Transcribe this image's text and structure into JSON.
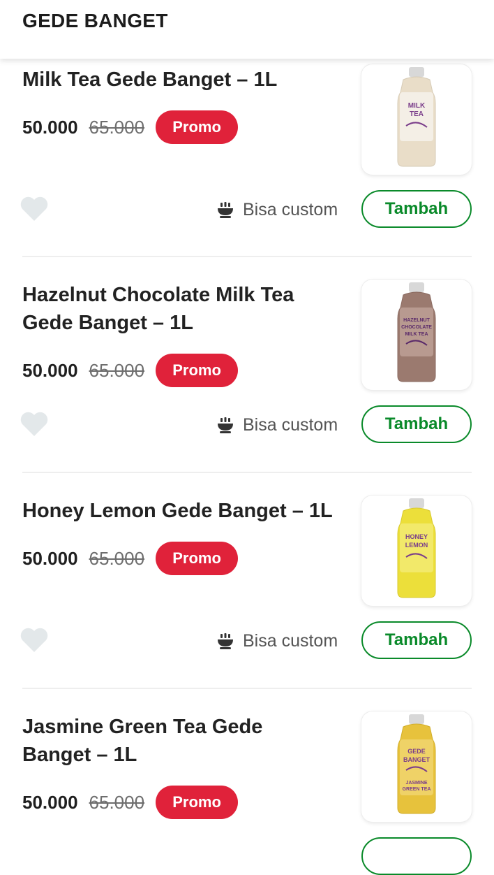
{
  "header": {
    "title": "GEDE BANGET"
  },
  "items": [
    {
      "name": "Milk Tea Gede Banget – 1L",
      "price": "50.000",
      "old_price": "65.000",
      "badge": "Promo",
      "custom_label": "Bisa custom",
      "add_label": "Tambah",
      "bottle": {
        "liquid": "#e9ddc8",
        "label": "#f4efe6",
        "brand": "#7a3d8a",
        "text": "MILK TEA"
      }
    },
    {
      "name": "Hazelnut Chocolate Milk Tea Gede Banget – 1L",
      "price": "50.000",
      "old_price": "65.000",
      "badge": "Promo",
      "custom_label": "Bisa custom",
      "add_label": "Tambah",
      "bottle": {
        "liquid": "#9b7a6f",
        "label": "#b89a90",
        "brand": "#5a2a6a",
        "text": "HAZELNUT CHOCOLATE"
      }
    },
    {
      "name": "Honey Lemon Gede Banget – 1L",
      "price": "50.000",
      "old_price": "65.000",
      "badge": "Promo",
      "custom_label": "Bisa custom",
      "add_label": "Tambah",
      "bottle": {
        "liquid": "#ecdf3a",
        "label": "#f2e96a",
        "brand": "#7a3d8a",
        "text": "HONEY LEMON"
      }
    },
    {
      "name": "Jasmine Green Tea Gede Banget – 1L",
      "price": "50.000",
      "old_price": "65.000",
      "badge": "Promo",
      "bottle": {
        "liquid": "#e7c23c",
        "label": "#efd267",
        "brand": "#7a3d8a",
        "text": "GEDE BANGET"
      }
    }
  ],
  "colors": {
    "promo": "#e0223a",
    "accent_green": "#0a8a2a",
    "heart": "#e3e8ea"
  },
  "icons": {
    "favorite": "heart-icon",
    "customizable": "bowl-icon",
    "product": "bottle-image"
  }
}
